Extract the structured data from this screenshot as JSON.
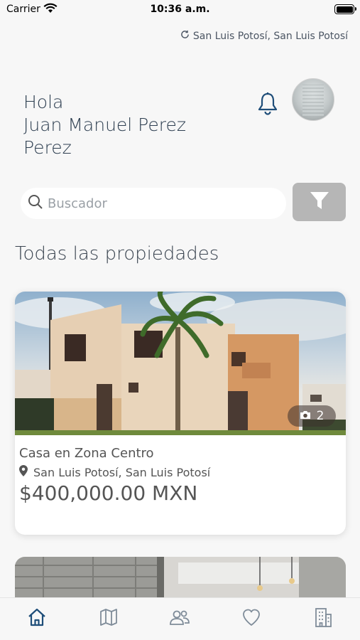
{
  "status_bar": {
    "carrier": "Carrier",
    "time": "10:36 a.m."
  },
  "location": {
    "current": "San Luis Potosí, San Luis Potosí",
    "icon": "refresh-icon"
  },
  "greeting": {
    "hello": "Hola",
    "name_line1": "Juan Manuel Perez",
    "name_line2": "Perez"
  },
  "search": {
    "placeholder": "Buscador",
    "value": ""
  },
  "section": {
    "title": "Todas las propiedades"
  },
  "properties": [
    {
      "title": "Casa en Zona Centro",
      "location": "San Luis Potosí, San Luis Potosí",
      "price": "$400,000.00 MXN",
      "photo_count": "2"
    }
  ],
  "tabs": [
    {
      "icon": "home-icon",
      "active": true
    },
    {
      "icon": "map-icon",
      "active": false
    },
    {
      "icon": "users-icon",
      "active": false
    },
    {
      "icon": "heart-icon",
      "active": false
    },
    {
      "icon": "building-icon",
      "active": false
    }
  ],
  "colors": {
    "accent": "#1f4e79",
    "tab_inactive": "#7f8c99",
    "filter_button": "#b6b6b6",
    "background": "#f7f7f7"
  }
}
